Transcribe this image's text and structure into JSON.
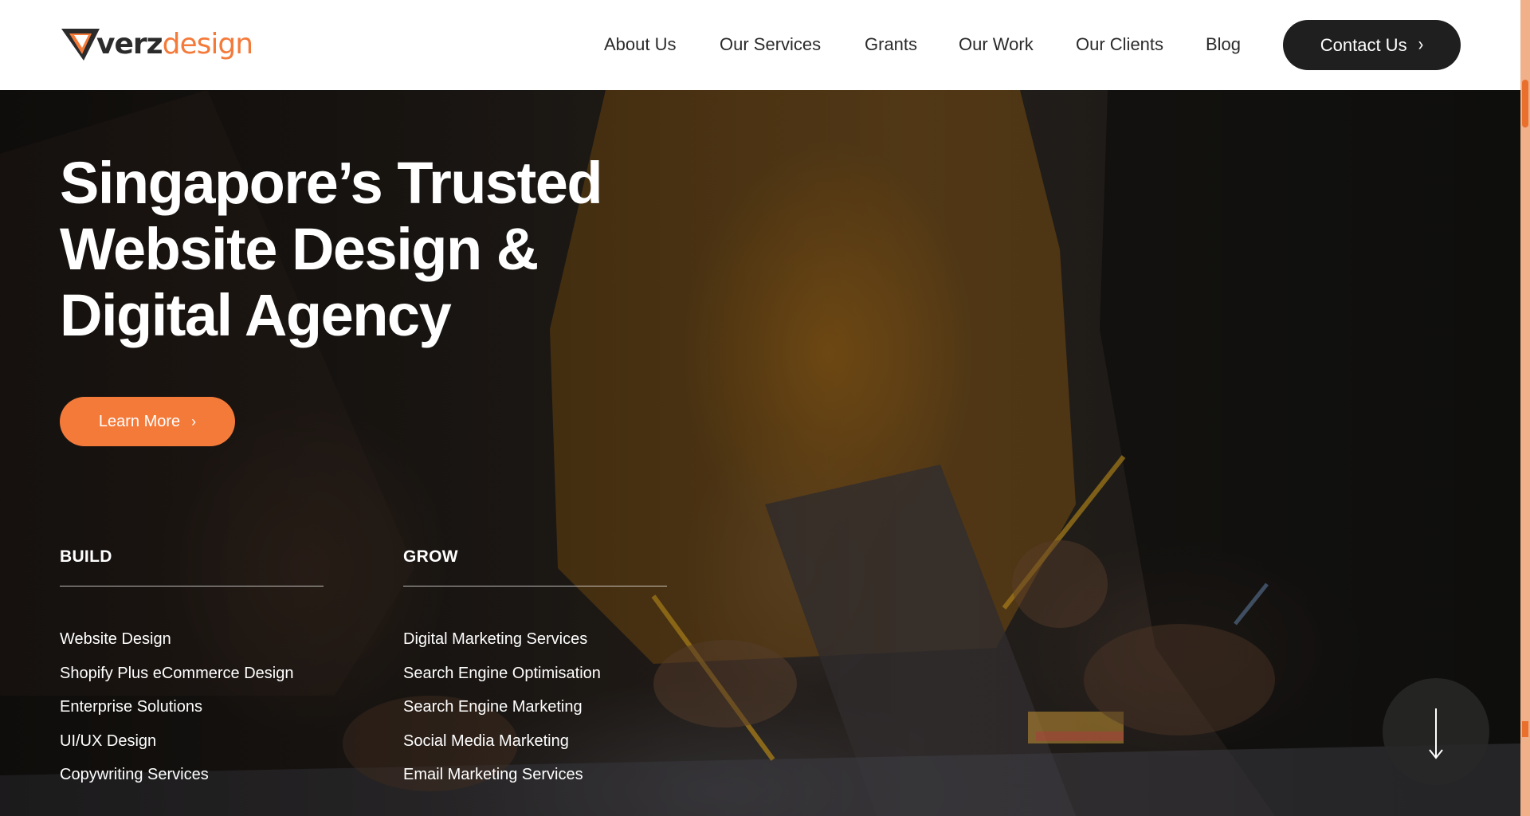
{
  "header": {
    "logo": {
      "part1": "verz",
      "part2": "design"
    },
    "nav": [
      "About Us",
      "Our Services",
      "Grants",
      "Our Work",
      "Our Clients",
      "Blog"
    ],
    "contact_label": "Contact Us"
  },
  "hero": {
    "headline": "Singapore’s Trusted Website Design & Digital Agency",
    "learn_more_label": "Learn More"
  },
  "columns": [
    {
      "title": "BUILD",
      "links": [
        "Website Design",
        "Shopify Plus eCommerce Design",
        "Enterprise Solutions",
        "UI/UX Design",
        "Copywriting Services"
      ]
    },
    {
      "title": "GROW",
      "links": [
        "Digital Marketing Services",
        "Search Engine Optimisation",
        "Search Engine Marketing",
        "Social Media Marketing",
        "Email Marketing Services"
      ]
    }
  ],
  "colors": {
    "accent": "#f47a3a",
    "dark": "#1f1f1f"
  },
  "icons": [
    "logo-mark-icon",
    "chevron-right-icon",
    "arrow-down-icon"
  ]
}
